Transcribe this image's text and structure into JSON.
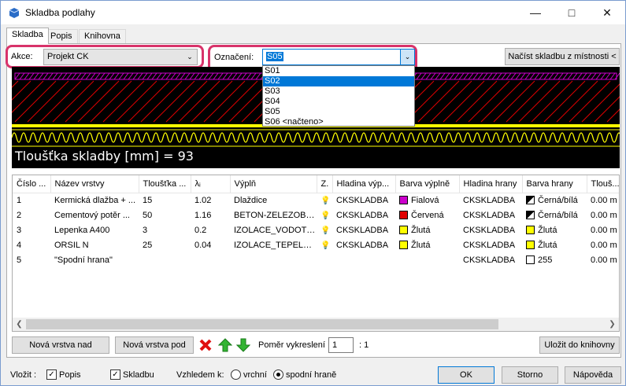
{
  "window": {
    "title": "Skladba podlahy"
  },
  "tabs": [
    {
      "label": "Skladba"
    },
    {
      "label": "Popis"
    },
    {
      "label": "Knihovna"
    }
  ],
  "akce": {
    "label": "Akce:",
    "value": "Projekt CK"
  },
  "oznaceni": {
    "label": "Označení:",
    "value": "S05",
    "options": [
      "S01",
      "S02",
      "S03",
      "S04",
      "S05",
      "S06 <načteno>"
    ],
    "highlighted": "S02"
  },
  "load_button": "Načíst skladbu z místnosti <",
  "drawing": {
    "thickness_label": "Tloušťka skladby [mm] = 93"
  },
  "table": {
    "headers": [
      "Číslo ...",
      "Název vrstvy",
      "Tloušťka ...",
      "λᵢ",
      "Výplň",
      "Z.",
      "Hladina výp...",
      "Barva výplně",
      "Hladina hrany",
      "Barva hrany",
      "Tlouš..."
    ],
    "rows": [
      {
        "num": "1",
        "name": "Kermická dlažba + ...",
        "thickness": "15",
        "lambda": "1.02",
        "fill": "Dlaždice",
        "fill_layer": "CKSKLADBA",
        "fill_color": "Fialová",
        "fill_color_hex": "#cc00cc",
        "edge_layer": "CKSKLADBA",
        "edge_color": "Černá/bílá",
        "edge_swatch": "bw",
        "thick2": "0.00 m"
      },
      {
        "num": "2",
        "name": "Cementový potěr ...",
        "thickness": "50",
        "lambda": "1.16",
        "fill": "BETON-ZELEZOBET...",
        "fill_layer": "CKSKLADBA",
        "fill_color": "Červená",
        "fill_color_hex": "#e00000",
        "edge_layer": "CKSKLADBA",
        "edge_color": "Černá/bílá",
        "edge_swatch": "bw",
        "thick2": "0.00 m"
      },
      {
        "num": "3",
        "name": "Lepenka A400",
        "thickness": "3",
        "lambda": "0.2",
        "fill": "IZOLACE_VODOTE...",
        "fill_layer": "CKSKLADBA",
        "fill_color": "Žlutá",
        "fill_color_hex": "#ffff00",
        "edge_layer": "CKSKLADBA",
        "edge_color": "Žlutá",
        "edge_swatch": "#ffff00",
        "thick2": "0.00 m"
      },
      {
        "num": "4",
        "name": "ORSIL N",
        "thickness": "25",
        "lambda": "0.04",
        "fill": "IZOLACE_TEPELNA_U",
        "fill_layer": "CKSKLADBA",
        "fill_color": "Žlutá",
        "fill_color_hex": "#ffff00",
        "edge_layer": "CKSKLADBA",
        "edge_color": "Žlutá",
        "edge_swatch": "#ffff00",
        "thick2": "0.00 m"
      },
      {
        "num": "5",
        "name": "\"Spodní hrana\"",
        "thickness": "",
        "lambda": "",
        "fill": "",
        "fill_layer": "",
        "fill_color": "",
        "fill_color_hex": "",
        "edge_layer": "CKSKLADBA",
        "edge_color": "255",
        "edge_swatch": "#ffffff",
        "thick2": "0.00 m"
      }
    ]
  },
  "buttons": {
    "new_above": "Nová vrstva nad",
    "new_below": "Nová vrstva pod",
    "save_library": "Uložit do knihovny",
    "ok": "OK",
    "cancel": "Storno",
    "help": "Nápověda"
  },
  "scale": {
    "label": "Poměr vykreslení",
    "value": "1",
    "suffix": ": 1"
  },
  "insert": {
    "label": "Vložit :",
    "popis": "Popis",
    "skladbu": "Skladbu",
    "vzhledem": "Vzhledem k:",
    "top": "vrchní",
    "bottom": "spodní hraně"
  },
  "colors": {
    "highlight_box": "#d8336a",
    "selection": "#0078d7"
  }
}
